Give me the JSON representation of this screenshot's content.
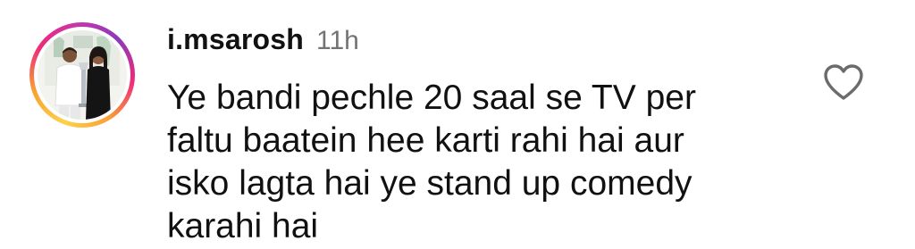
{
  "comment": {
    "username": "i.msarosh",
    "timestamp": "11h",
    "text_lines": [
      "Ye bandi pechle 20 saal se TV per",
      "faltu baatein hee karti rahi hai aur",
      "isko lagta hai ye stand up comedy",
      "karahi hai"
    ],
    "avatar": {
      "story_ring": true,
      "ring_colors": [
        "#fdd14a",
        "#f9a134",
        "#ee2a7b",
        "#c837ab",
        "#8a3ab9"
      ]
    },
    "like_icon": "heart-outline-icon"
  }
}
